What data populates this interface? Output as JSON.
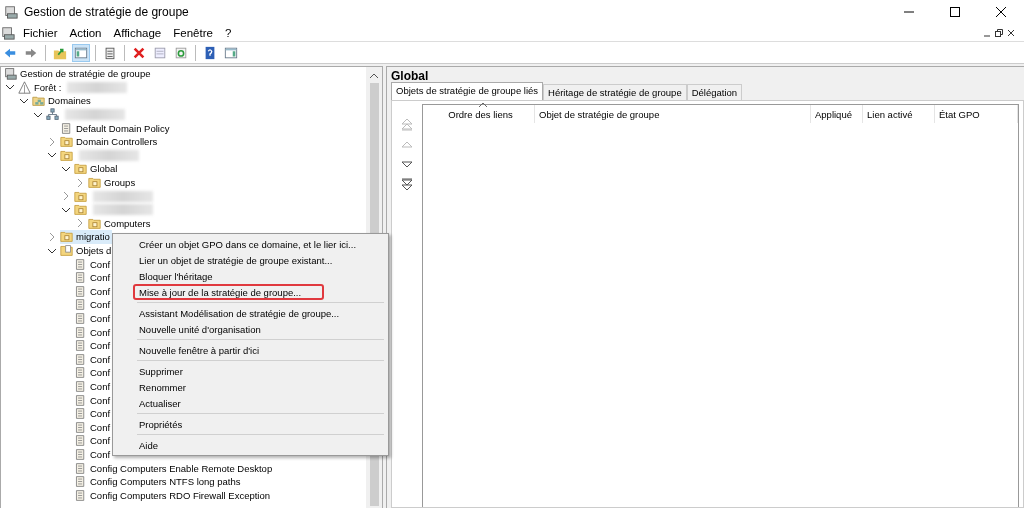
{
  "window": {
    "title": "Gestion de stratégie de groupe"
  },
  "menu_bar": [
    "Fichier",
    "Action",
    "Affichage",
    "Fenêtre",
    "?"
  ],
  "toolbar": [
    {
      "kind": "back",
      "pressed": false
    },
    {
      "kind": "forward",
      "pressed": false
    },
    {
      "kind": "sep"
    },
    {
      "kind": "up",
      "pressed": false
    },
    {
      "kind": "tree",
      "pressed": true
    },
    {
      "kind": "sep"
    },
    {
      "kind": "clipboard",
      "pressed": false
    },
    {
      "kind": "sep"
    },
    {
      "kind": "delete",
      "pressed": false
    },
    {
      "kind": "properties",
      "pressed": false
    },
    {
      "kind": "refresh",
      "pressed": false
    },
    {
      "kind": "sep"
    },
    {
      "kind": "help",
      "pressed": false
    },
    {
      "kind": "pane",
      "pressed": false
    }
  ],
  "tree": [
    {
      "label": "Gestion de stratégie de groupe",
      "kind": "console",
      "selected": false,
      "children": [
        {
          "label": "Forêt :",
          "redacted": true,
          "kind": "forest",
          "expanded": true,
          "selected": false,
          "children": [
            {
              "label": "Domaines",
              "kind": "domains",
              "expanded": true,
              "selected": false,
              "children": [
                {
                  "redacted": true,
                  "kind": "domain",
                  "expanded": true,
                  "selected": false,
                  "children": [
                    {
                      "label": "Default Domain Policy",
                      "kind": "gpo",
                      "selected": false
                    },
                    {
                      "label": "Domain Controllers",
                      "kind": "ou",
                      "expanded": false,
                      "selected": false
                    },
                    {
                      "redacted": true,
                      "kind": "ou",
                      "expanded": true,
                      "selected": false,
                      "children": [
                        {
                          "label": "Global",
                          "kind": "ou",
                          "expanded": true,
                          "selected": false,
                          "children": [
                            {
                              "label": "Groups",
                              "kind": "ou",
                              "expanded": false,
                              "selected": false
                            }
                          ]
                        },
                        {
                          "redacted": true,
                          "kind": "ou",
                          "expanded": false,
                          "selected": false
                        },
                        {
                          "redacted": true,
                          "kind": "ou",
                          "expanded": true,
                          "selected": false,
                          "children": [
                            {
                              "label": "Computers",
                              "kind": "ou",
                              "expanded": false,
                              "selected": false
                            }
                          ]
                        }
                      ]
                    },
                    {
                      "label": "migratio",
                      "kind": "ou",
                      "expanded": false,
                      "selected": true
                    },
                    {
                      "label": "Objets d",
                      "kind": "gpofolder",
                      "expanded": true,
                      "selected": false,
                      "children": [
                        {
                          "label": "Conf",
                          "kind": "gpo",
                          "selected": false
                        },
                        {
                          "label": "Conf",
                          "kind": "gpo",
                          "selected": false
                        },
                        {
                          "label": "Conf",
                          "kind": "gpo",
                          "selected": false
                        },
                        {
                          "label": "Conf",
                          "kind": "gpo",
                          "selected": false
                        },
                        {
                          "label": "Conf",
                          "kind": "gpo",
                          "selected": false
                        },
                        {
                          "label": "Conf",
                          "kind": "gpo",
                          "selected": false
                        },
                        {
                          "label": "Conf",
                          "kind": "gpo",
                          "selected": false
                        },
                        {
                          "label": "Conf",
                          "kind": "gpo",
                          "selected": false
                        },
                        {
                          "label": "Conf",
                          "kind": "gpo",
                          "selected": false
                        },
                        {
                          "label": "Conf",
                          "kind": "gpo",
                          "selected": false
                        },
                        {
                          "label": "Conf",
                          "kind": "gpo",
                          "selected": false
                        },
                        {
                          "label": "Conf",
                          "kind": "gpo",
                          "selected": false
                        },
                        {
                          "label": "Conf",
                          "kind": "gpo",
                          "selected": false
                        },
                        {
                          "label": "Conf",
                          "kind": "gpo",
                          "selected": false
                        },
                        {
                          "label": "Conf",
                          "kind": "gpo",
                          "selected": false
                        },
                        {
                          "label": "Config Computers Enable Remote Desktop",
                          "kind": "gpo",
                          "selected": false
                        },
                        {
                          "label": "Config Computers NTFS long paths",
                          "kind": "gpo",
                          "selected": false
                        },
                        {
                          "label": "Config Computers RDO Firewall Exception",
                          "kind": "gpo",
                          "selected": false
                        }
                      ]
                    }
                  ]
                }
              ]
            }
          ]
        }
      ]
    }
  ],
  "context_menu": [
    [
      {
        "label": "Créer un objet GPO dans ce domaine, et le lier ici...",
        "highlighted": false
      },
      {
        "label": "Lier un objet de stratégie de groupe existant...",
        "highlighted": false
      },
      {
        "label": "Bloquer l'héritage",
        "highlighted": false
      },
      {
        "label": "Mise à jour de la stratégie de groupe...",
        "highlighted": true
      }
    ],
    [
      {
        "label": "Assistant Modélisation de stratégie de groupe...",
        "highlighted": false
      },
      {
        "label": "Nouvelle unité d'organisation",
        "highlighted": false
      }
    ],
    [
      {
        "label": "Nouvelle fenêtre à partir d'ici",
        "highlighted": false
      }
    ],
    [
      {
        "label": "Supprimer",
        "highlighted": false
      },
      {
        "label": "Renommer",
        "highlighted": false
      },
      {
        "label": "Actualiser",
        "highlighted": false
      }
    ],
    [
      {
        "label": "Propriétés",
        "highlighted": false
      }
    ],
    [
      {
        "label": "Aide",
        "highlighted": false
      }
    ]
  ],
  "details": {
    "title": "Global",
    "tabs": [
      {
        "label": "Objets de stratégie de groupe liés",
        "selected": true
      },
      {
        "label": "Héritage de stratégie de groupe",
        "selected": false
      },
      {
        "label": "Délégation",
        "selected": false
      }
    ],
    "move_buttons": [
      {
        "kind": "top",
        "disabled": true
      },
      {
        "kind": "up",
        "disabled": true
      },
      {
        "kind": "down",
        "disabled": false
      },
      {
        "kind": "bottom",
        "disabled": false
      }
    ],
    "columns": [
      {
        "label": "Ordre des liens",
        "sorted": true
      },
      {
        "label": "Objet de stratégie de groupe",
        "sorted": false
      },
      {
        "label": "Appliqué",
        "sorted": false
      },
      {
        "label": "Lien activé",
        "sorted": false
      },
      {
        "label": "État GPO",
        "sorted": false
      }
    ]
  }
}
